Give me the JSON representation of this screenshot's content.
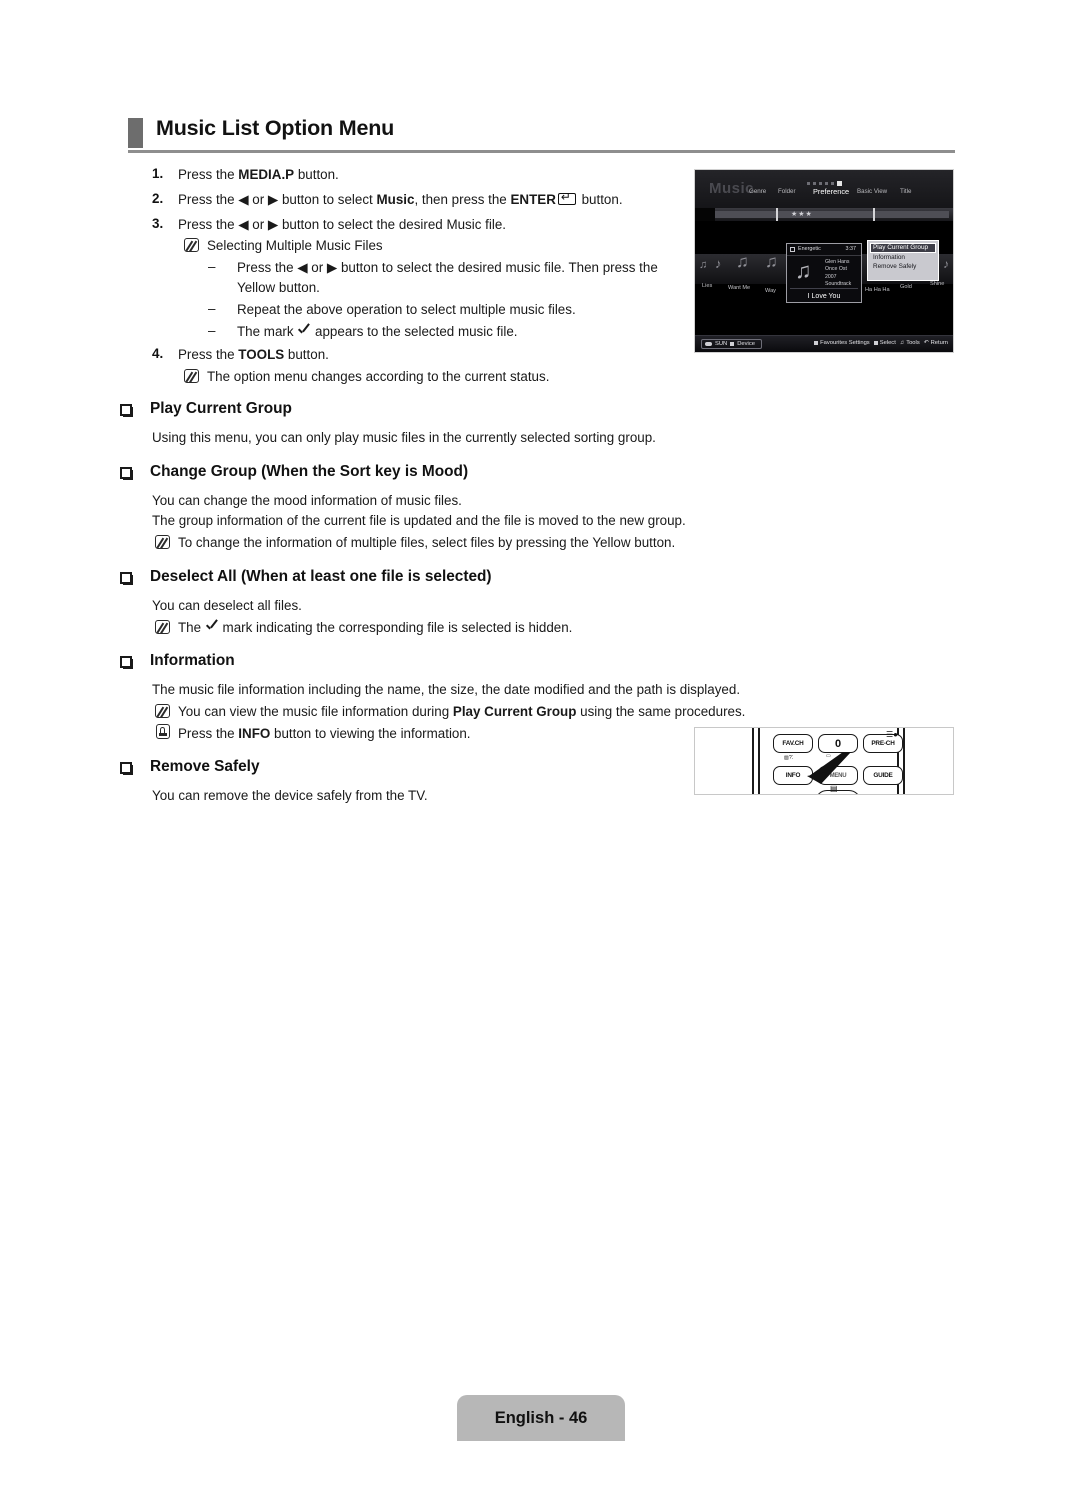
{
  "page": {
    "title": "Music List Option Menu",
    "footer_label": "English - 46"
  },
  "steps": [
    {
      "num": "1.",
      "pre": "Press the ",
      "bold": "MEDIA.P",
      "post": " button."
    },
    {
      "num": "2.",
      "pre": "Press the ◀ or ▶ button to select ",
      "bold": "Music",
      "mid": ", then press the ",
      "bold2": "ENTER",
      "post": " button."
    },
    {
      "num": "3.",
      "pre": "Press the ◀ or ▶ button to select the desired Music file.",
      "bold": "",
      "post": ""
    },
    {
      "num": "4.",
      "pre": "Press the ",
      "bold": "TOOLS",
      "post": " button."
    }
  ],
  "notes": {
    "selecting_multiple": "Selecting Multiple Music Files",
    "dash1_a": "Press the ◀ or ▶ button to select the desired music file. Then press the",
    "dash1_b": "Yellow button.",
    "dash2": "Repeat the above operation to select multiple music files.",
    "dash3_pre": "The mark",
    "dash3_post": "appears to the selected music file.",
    "option_menu_changes": "The option menu changes according to the current status."
  },
  "sections": [
    {
      "heading": "Play Current Group",
      "lines": [
        "Using this menu, you can only play music files in the currently selected sorting group."
      ]
    },
    {
      "heading": "Change Group (When the Sort key is Mood)",
      "lines": [
        "You can change the mood information of music files.",
        "The group information of the current file is updated and the file is moved to the new group."
      ],
      "note": "To change the information of multiple files, select files by pressing the Yellow button."
    },
    {
      "heading": "Deselect All (When at least one file is selected)",
      "lines": [
        "You can deselect all files."
      ],
      "note_pre": "The",
      "note_post": "mark indicating the corresponding file is selected is hidden."
    },
    {
      "heading": "Information",
      "lines": [
        "The music file information including the name, the size, the date modified and the path is displayed."
      ],
      "note_pre": "You can view the music file information during ",
      "note_bold": "Play Current Group",
      "note_post": " using the same procedures.",
      "press_pre": "Press the ",
      "press_bold": "INFO",
      "press_post": " button to viewing the information."
    },
    {
      "heading": "Remove Safely",
      "lines": [
        "You can remove the device safely from the TV."
      ]
    }
  ],
  "tv_screenshot": {
    "watermark": "Music",
    "nav": [
      "Genre",
      "Folder",
      "Preference",
      "Basic View",
      "Title"
    ],
    "nav_current": "Preference",
    "rating_stars": "★★★",
    "tracks": [
      "Lies",
      "Want Me",
      "Way",
      "Ha Ha Ha",
      "Gold",
      "Shine"
    ],
    "card": {
      "mood": "Energetic",
      "duration": "3:37",
      "meta": [
        "Glen Hans",
        "Once Ost",
        "2007",
        "Soundtrack"
      ],
      "title": "I Love You"
    },
    "menu": [
      "Play Current Group",
      "Information",
      "Remove Safely"
    ],
    "menu_selected": "Play Current Group",
    "footer": {
      "source": "SUN",
      "device": "Device",
      "actions": [
        "Favourites Settings",
        "Select",
        "Tools",
        "Return"
      ]
    }
  },
  "remote": {
    "buttons": [
      "FAV.CH",
      "0",
      "PRE-CH",
      "INFO",
      "MENU",
      "GUIDE"
    ],
    "highlighted": "INFO"
  }
}
